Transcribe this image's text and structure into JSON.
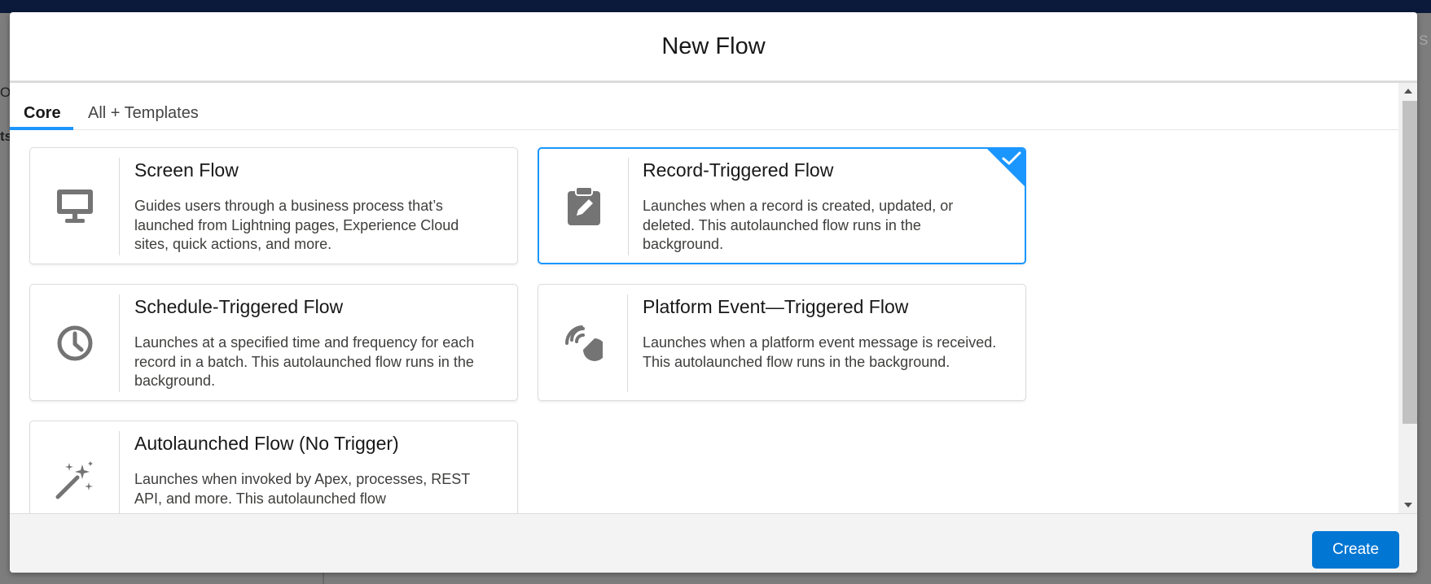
{
  "background": {
    "left_fragments": [
      "O",
      "ts"
    ],
    "right_fragment": "S"
  },
  "modal": {
    "title": "New Flow",
    "tabs": [
      {
        "label": "Core",
        "active": true
      },
      {
        "label": "All + Templates",
        "active": false
      }
    ],
    "cards": [
      {
        "title": "Screen Flow",
        "description": "Guides users through a business process that’s launched from Lightning pages, Experience Cloud sites, quick actions, and more.",
        "icon": "desktop-icon",
        "selected": false
      },
      {
        "title": "Record-Triggered Flow",
        "description": "Launches when a record is created, updated, or deleted. This autolaunched flow runs in the background.",
        "icon": "clipboard-edit-icon",
        "selected": true
      },
      {
        "title": "Schedule-Triggered Flow",
        "description": "Launches at a specified time and frequency for each record in a batch. This autolaunched flow runs in the background.",
        "icon": "clock-icon",
        "selected": false
      },
      {
        "title": "Platform Event—Triggered Flow",
        "description": "Launches when a platform event message is received. This autolaunched flow runs in the background.",
        "icon": "platform-event-icon",
        "selected": false
      },
      {
        "title": "Autolaunched Flow (No Trigger)",
        "description": "Launches when invoked by Apex, processes, REST API, and more. This autolaunched flow",
        "icon": "magic-wand-icon",
        "selected": false
      }
    ],
    "footer": {
      "create_label": "Create"
    }
  },
  "colors": {
    "accent": "#1b96ff",
    "brand_button": "#0176d3",
    "icon_gray": "#747474"
  }
}
